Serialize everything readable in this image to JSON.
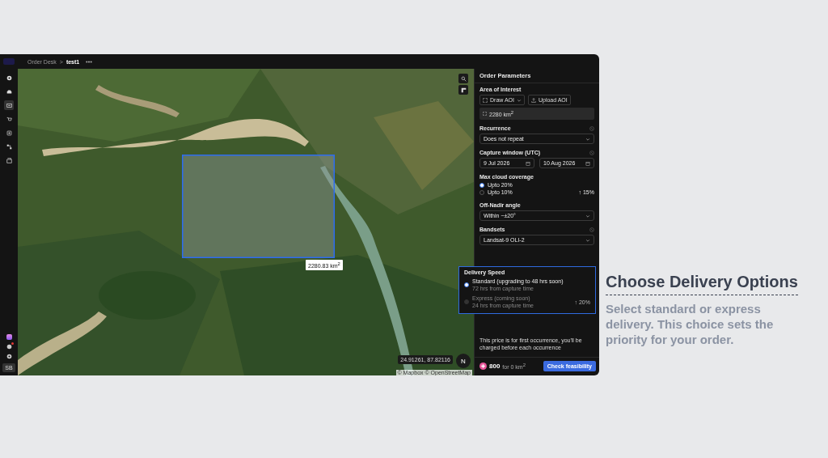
{
  "topbar": {
    "breadcrumb": "Order Desk",
    "separator": ">",
    "current": "test1"
  },
  "sidebar": {
    "items": [
      {
        "selected": false
      },
      {
        "selected": false
      },
      {
        "selected": true
      },
      {
        "selected": false
      },
      {
        "selected": false
      },
      {
        "selected": false
      },
      {
        "selected": false
      }
    ],
    "avatar": "SB",
    "notification": true
  },
  "map": {
    "aoi_label": "2280.83 km$^{2}$",
    "coordinates": "24.91261, 87.82116",
    "compass": "N",
    "attribution": "© Mapbox © OpenStreetMap"
  },
  "panel": {
    "title": "Order Parameters",
    "area_of_interest": {
      "label": "Area of Interest",
      "draw_button": "Draw AOI",
      "upload_button": "Upload AOI",
      "area": "2280 km$^{2}$"
    },
    "recurrence": {
      "label": "Recurrence",
      "value": "Does not repeat"
    },
    "capture_window": {
      "label": "Capture window (UTC)",
      "start": "9 Jul 2026",
      "end": "10 Aug 2026"
    },
    "cloud_coverage": {
      "label": "Max cloud coverage",
      "options": [
        {
          "label": "Upto 20%",
          "selected": true
        },
        {
          "label": "Upto 10%",
          "selected": false,
          "price_change": "↑ 15%"
        }
      ]
    },
    "off_nadir": {
      "label": "Off-Nadir angle",
      "value": "Within ~±20°"
    },
    "bandsets": {
      "label": "Bandsets",
      "value": "Landsat-9 OLI-2"
    },
    "note": "This price is for first occurrence, you'll be charged before each occurrence",
    "price": {
      "amount": "800",
      "unit": "for 0 km$^{2}$"
    },
    "submit_button": "Check feasibility"
  },
  "delivery_popup": {
    "title": "Delivery Speed",
    "options": [
      {
        "label": "Standard (upgrading to 48 hrs soon)",
        "detail": "72 hrs from capture time",
        "selected": true,
        "disabled": false
      },
      {
        "label": "Express (coming soon)",
        "detail": "24 hrs from capture time",
        "selected": false,
        "disabled": true,
        "price_change": "↑ 20%"
      }
    ]
  },
  "callout": {
    "title": "Choose Delivery Options",
    "text": "Select standard or express delivery. This choice sets the priority for your order."
  }
}
